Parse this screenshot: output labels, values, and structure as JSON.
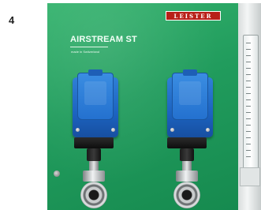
{
  "step": {
    "number": "4"
  },
  "photo": {
    "brand_logo": "LEISTER",
    "product_title": "AIRSTREAM ST",
    "subtitle": "made in Switzerland",
    "panel_color": "#219c5d",
    "socket_color": "#2471cf",
    "logo_color": "#b82018"
  }
}
